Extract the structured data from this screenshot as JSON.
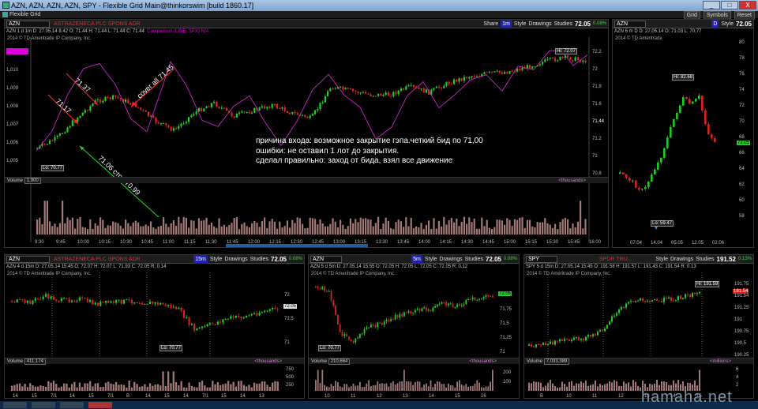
{
  "window": {
    "title": "AZN, AZN, AZN, AZN, SPY - Flexible Grid Main@thinkorswim [build 1860.17]",
    "minimize": "_",
    "maximize": "□",
    "close": "X"
  },
  "menubar": {
    "label": "Flexible Grid",
    "tools": [
      "Grid",
      "Symbols",
      "Reset"
    ]
  },
  "chart_data": [
    {
      "type": "candlestick",
      "symbol": "AZN",
      "description": "ASTRAZENECA PLC SPONS ADR",
      "timeframe": "1m",
      "info": "AZN 1 d 1m  D: 27.05.14 8:42  O: 71.44  H: 71.44  L: 71.44  C: 71.44",
      "comparison": "Comparison (LINE, SPX)  N/A",
      "copyright": "2014 © TD Ameritrade IP Company, Inc.",
      "price": "72.05",
      "change": "0.08%",
      "ylabels": [
        "1.011.31",
        "1,010",
        "1,009",
        "1,008",
        "1,007",
        "1,006",
        "1,005"
      ],
      "y2labels": [
        "72.2",
        "72",
        "71.8",
        "71.6",
        "71.44",
        "71.2",
        "71",
        "70.8"
      ],
      "ylim": [
        70.7,
        72.2
      ],
      "xlabels": [
        "9:30",
        "9:45",
        "10:00",
        "10:15",
        "10:30",
        "10:45",
        "11:00",
        "11:15",
        "11:30",
        "11:45",
        "12:00",
        "12:15",
        "12:30",
        "12:45",
        "13:00",
        "13:15",
        "13:30",
        "13:45",
        "14:00",
        "14:15",
        "14:30",
        "14:45",
        "15:00",
        "15:15",
        "15:30",
        "15:45",
        "16:00"
      ],
      "hi_label": "Hi: 72.07",
      "lo_label": "Lo: 70.77",
      "close_label": "71.44",
      "volume_label": "1,900",
      "volume_unit": "<thousands>",
      "annotations": [
        "71.37",
        "71.17",
        "cover all 71.45",
        "71.06 стоп 70.99"
      ],
      "notes": [
        "причина входа: возможное закрытие гэпа.четкий бид по 71,00",
        "ошибки: не оставил 1 лот до закрытия.",
        "сделал правильно: заход от бида, взял все движение"
      ]
    },
    {
      "type": "candlestick",
      "symbol": "AZN",
      "timeframe": "D",
      "info": "AZN 6 m D  D: 27.05.14  O: 71.03  L: 70.77",
      "copyright": "2014 © TD Ameritrade",
      "price": "72.05",
      "change": "0.08%",
      "ylabels": [
        "80",
        "78",
        "76",
        "74",
        "72",
        "70",
        "68",
        "66",
        "64",
        "62",
        "60",
        "58"
      ],
      "xlabels": [
        "07.04",
        "14.04",
        "05.05",
        "12.05",
        "02.06"
      ],
      "hi_label": "Hi: 82.68",
      "lo_label": "Lo: 59.47",
      "last_label": "72.05"
    },
    {
      "type": "candlestick",
      "symbol": "AZN",
      "description": "ASTRAZENECA PLC SPONS ADR",
      "timeframe": "15m",
      "info": "AZN 4 d 15m  D: 27.05.14 15:45  O: 72.07  H: 72.07  L: 71.93  C: 72.05  R: 0.14",
      "copyright": "2014 © TD Ameritrade IP Company, Inc.",
      "price": "72.05",
      "change": "0.08%",
      "ylabels": [
        "72",
        "71.5",
        "71"
      ],
      "lo_label": "Lo: 70.77",
      "last_label": "72.05",
      "volume_label": "411,174",
      "volume_unit": "<thousands>",
      "vlabels": [
        "750",
        "500",
        "250"
      ],
      "xlabels": [
        "14",
        "15",
        "7/1",
        "14",
        "15",
        "7/1",
        "B",
        "14",
        "15",
        "14",
        "7/1",
        "15",
        "14",
        "13"
      ]
    },
    {
      "type": "candlestick",
      "symbol": "AZN",
      "timeframe": "5m",
      "info": "AZN 5 d 5m  D: 27.05.14 15:55  O: 72.05  H: 72.05  L: 72.05  C: 72.05  R: 0.12",
      "copyright": "2014 © TD Ameritrade IP Company, Inc.",
      "price": "72.05",
      "change": "0.08%",
      "ylabels": [
        "72",
        "71.75",
        "71.5",
        "71.25",
        "71"
      ],
      "lo_label": "Lo: 70.77",
      "last_label": "72.05",
      "volume_label": "210,664",
      "volume_unit": "<thousands>",
      "vlabels": [
        "200",
        "100"
      ],
      "xlabels": [
        "10",
        "11",
        "12",
        "13",
        "14",
        "15",
        "16"
      ]
    },
    {
      "type": "candlestick",
      "symbol": "SPY",
      "description": "SPDR TRU...",
      "timeframe": "15m",
      "info": "SPY 5 d 15m  D: 27.05.14 15:45  O: 191.58  H: 191.57  L: 191.43  C: 191.54  R: 0.13",
      "copyright": "2014 © TD Ameritrade IP Company, Inc.",
      "price": "191.52",
      "change": "0.13%",
      "ylabels": [
        "191.75",
        "191.54",
        "191.25",
        "191",
        "190.75",
        "190.5",
        "190.25"
      ],
      "hi_label": "Hi: 191.59",
      "last_label": "191.54",
      "volume_label": "7,033,389",
      "volume_unit": "<millions>",
      "vlabels": [
        "6",
        "4",
        "2"
      ],
      "xlabels": [
        "B",
        "10",
        "11",
        "12",
        "13",
        "14",
        "15"
      ]
    }
  ],
  "toolbar": {
    "share": "Share",
    "style": "Style",
    "drawings": "Drawings",
    "studies": "Studies",
    "volume": "Volume"
  },
  "watermark": "hamaha.net",
  "colors": {
    "up": "#22cc22",
    "down": "#dd2222",
    "comparison": "#cc22cc",
    "arrow_red": "#ff2222",
    "arrow_green": "#22cc22"
  }
}
